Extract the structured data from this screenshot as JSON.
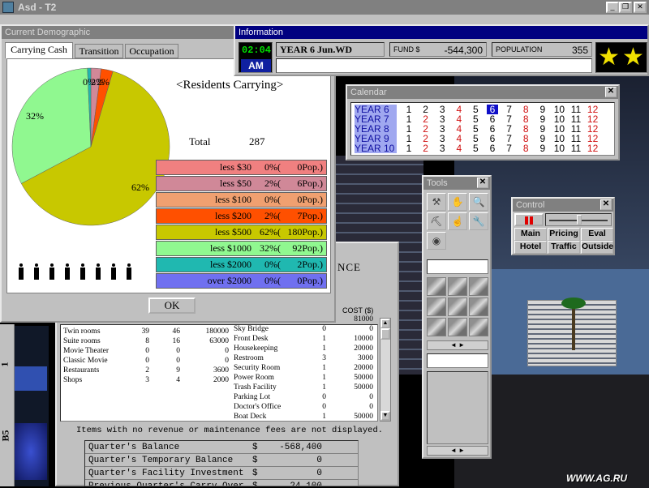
{
  "main_window": {
    "title": "Asd - T2",
    "menu": [
      "File",
      "Function",
      "Favorite",
      "Window",
      "Help"
    ],
    "controls": [
      "_",
      "❐",
      "✕"
    ]
  },
  "demographic": {
    "title": "Current Demographic",
    "tabs": [
      "Carrying Cash",
      "Transition",
      "Occupation"
    ],
    "chart_title": "<Residents Carrying>",
    "total_label": "Total",
    "total_value": "287",
    "pie_labels": [
      "32%",
      "62%",
      "0%",
      "2%",
      "2%"
    ],
    "legend": [
      {
        "label": "less $30",
        "pct": "0%(",
        "pop": "0Pop.)",
        "color": "#f08080"
      },
      {
        "label": "less $50",
        "pct": "2%(",
        "pop": "6Pop.)",
        "color": "#d08898"
      },
      {
        "label": "less $100",
        "pct": "0%(",
        "pop": "0Pop.)",
        "color": "#f0a070"
      },
      {
        "label": "less $200",
        "pct": "2%(",
        "pop": "7Pop.)",
        "color": "#ff5000"
      },
      {
        "label": "less $500",
        "pct": "62%(",
        "pop": "180Pop.)",
        "color": "#c8c800"
      },
      {
        "label": "less $1000",
        "pct": "32%(",
        "pop": "92Pop.)",
        "color": "#90f890"
      },
      {
        "label": "less $2000",
        "pct": "0%(",
        "pop": "2Pop.)",
        "color": "#20b8b0"
      },
      {
        "label": "over $2000",
        "pct": "0%(",
        "pop": "0Pop.)",
        "color": "#7070f0"
      }
    ],
    "ok_label": "OK"
  },
  "chart_data": {
    "type": "pie",
    "title": "<Residents Carrying>",
    "categories": [
      "less $30",
      "less $50",
      "less $100",
      "less $200",
      "less $500",
      "less $1000",
      "less $2000",
      "over $2000"
    ],
    "values": [
      0,
      6,
      0,
      7,
      180,
      92,
      2,
      0
    ],
    "colors": [
      "#f08080",
      "#d08898",
      "#f0a070",
      "#ff5000",
      "#c8c800",
      "#90f890",
      "#20b8b0",
      "#7070f0"
    ]
  },
  "information": {
    "title": "Information",
    "time": "02:04",
    "ampm": "AM",
    "date": "YEAR 6 Jun.WD",
    "fund_label": "FUND $",
    "fund_value": "-544,300",
    "population_label": "POPULATION",
    "population_value": "355"
  },
  "calendar": {
    "title": "Calendar",
    "years": [
      "YEAR 6",
      "YEAR 7",
      "YEAR 8",
      "YEAR 9",
      "YEAR 10"
    ],
    "months": [
      "1",
      "2",
      "3",
      "4",
      "5",
      "6",
      "7",
      "8",
      "9",
      "10",
      "11",
      "12"
    ],
    "red_months": [
      "4",
      "8",
      "12"
    ]
  },
  "tools": {
    "title": "Tools"
  },
  "control": {
    "title": "Control",
    "buttons": [
      "Main",
      "Pricing",
      "Eval",
      "Hotel",
      "Traffic",
      "Outside"
    ]
  },
  "finance": {
    "header_fragment": "NCE",
    "cost_header": "COST ($)",
    "left_rows": [
      [
        "Twin rooms",
        "39",
        "46",
        "180000"
      ],
      [
        "Suite rooms",
        "8",
        "16",
        "63000"
      ],
      [
        "Movie Theater",
        "0",
        "0",
        "0"
      ],
      [
        "Classic Movie",
        "0",
        "0",
        "0"
      ],
      [
        "Restaurants",
        "2",
        "9",
        "3600"
      ],
      [
        "Shops",
        "3",
        "4",
        "2000"
      ]
    ],
    "right_rows": [
      [
        "",
        "",
        "81000"
      ],
      [
        "Sky Bridge",
        "0",
        "0"
      ],
      [
        "Front Desk",
        "1",
        "10000"
      ],
      [
        "Housekeeping",
        "1",
        "20000"
      ],
      [
        "Restroom",
        "3",
        "3000"
      ],
      [
        "Security Room",
        "1",
        "20000"
      ],
      [
        "Power Room",
        "1",
        "50000"
      ],
      [
        "Trash Facility",
        "1",
        "50000"
      ],
      [
        "Parking Lot",
        "0",
        "0"
      ],
      [
        "Doctor's Office",
        "0",
        "0"
      ],
      [
        "Boat Deck",
        "1",
        "50000"
      ]
    ],
    "note": "Items with no revenue or maintenance fees are not displayed.",
    "summary": [
      [
        "Quarter's Balance",
        "$",
        "-568,400"
      ],
      [
        "Quarter's Temporary Balance",
        "$",
        "0"
      ],
      [
        "Quarter's Facility Investment",
        "$",
        "0"
      ],
      [
        "Previous Quarter's Carry Over",
        "$",
        "24,100"
      ]
    ]
  },
  "floors": {
    "label_1": "1",
    "label_b5": "B5"
  },
  "watermark": "WWW.AG.RU",
  "colors": {
    "title_active": "#000080",
    "title_inactive": "#808080",
    "calendar_highlight": "#1010c8",
    "lcd_green": "#00e000"
  }
}
